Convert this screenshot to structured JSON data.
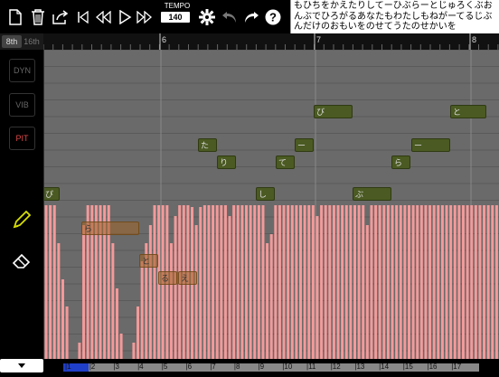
{
  "toolbar": {
    "icons": [
      "new-file-icon",
      "trash-icon",
      "export-icon",
      "skip-start-icon",
      "rewind-icon",
      "play-icon",
      "fast-forward-icon",
      "gear-icon",
      "undo-icon",
      "redo-icon",
      "help-icon"
    ],
    "tempo_label": "TEMPO",
    "tempo_value": "140"
  },
  "lyrics": {
    "text": "もひちをかえたりしてーひぶらーとじゅろくぶおんぶでひろがるあなたもわたしもねがーてるじぶんだけのおもいをのせてうたのせかいを"
  },
  "tabs": {
    "eighth": "8th",
    "sixteenth": "16th"
  },
  "ruler": {
    "marks": [
      "6",
      "7",
      "8"
    ]
  },
  "params": {
    "dyn": "DYN",
    "vib": "VIB",
    "pit": "PIT"
  },
  "notes": [
    "ぴ",
    "た",
    "り",
    "ー",
    "て",
    "と",
    "ー",
    "ら",
    "び",
    "し",
    "ぶ",
    "ら",
    "と",
    "る",
    "え"
  ],
  "mini_ruler": {
    "marks": [
      "1",
      "2",
      "3",
      "4",
      "5",
      "6",
      "7",
      "8",
      "9",
      "10",
      "11",
      "12",
      "13",
      "14",
      "15",
      "16",
      "17"
    ]
  },
  "colors": {
    "accent_pitch": "#e04a4a",
    "bars": "#f39a9a",
    "note": "#4a5a22",
    "selection": "#1f3fc8"
  }
}
